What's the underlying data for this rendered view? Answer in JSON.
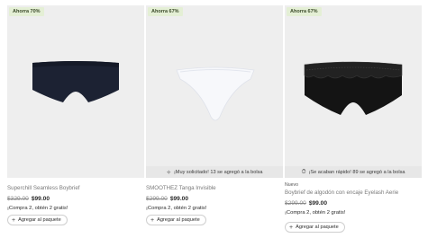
{
  "products": [
    {
      "badge": "Ahorra 70%",
      "urgency": null,
      "new_tag": null,
      "title": "Superchill Seamless Boybrief",
      "price_old": "$329.00",
      "price_new": "$99.00",
      "promo": "¡Compra 2, obtén 2 gratis!",
      "add_label": "Agregar al paquete",
      "product_color": "#1c2233"
    },
    {
      "badge": "Ahorra 67%",
      "urgency": "¡Muy solicitado! 13 se agregó a la bolsa",
      "urgency_icon": "sparkle-icon",
      "new_tag": null,
      "title": "SMOOTHEZ Tanga Invisible",
      "price_old": "$299.00",
      "price_new": "$99.00",
      "promo": "¡Compra 2, obtén 2 gratis!",
      "add_label": "Agregar al paquete",
      "product_color": "#ffffff"
    },
    {
      "badge": "Ahorra 67%",
      "urgency": "¡Se acaban rápido! 89 se agregó a la bolsa",
      "urgency_icon": "timer-icon",
      "new_tag": "Nuevo",
      "title": "Boybrief de algodón con encaje Eyelash Aerie",
      "price_old": "$299.00",
      "price_new": "$99.00",
      "promo": "¡Compra 2, obtén 2 gratis!",
      "add_label": "Agregar al paquete",
      "product_color": "#141414"
    }
  ],
  "icons": {
    "plus": "+",
    "sparkle": "✧",
    "timer": "⏱"
  }
}
